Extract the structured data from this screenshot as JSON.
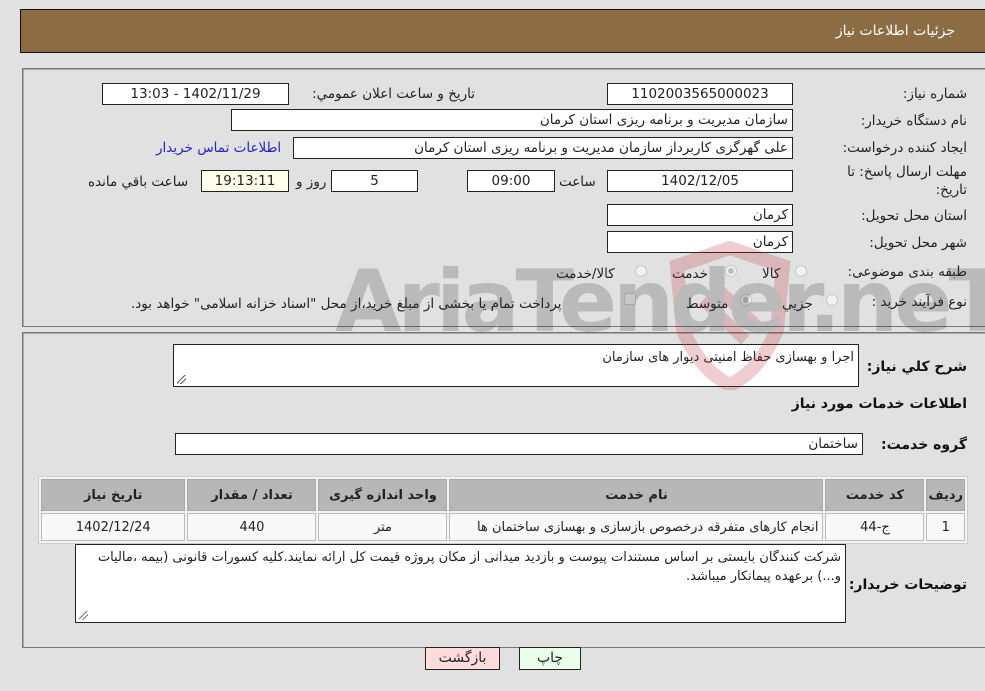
{
  "header": {
    "title": "جزئیات اطلاعات نیاز"
  },
  "fields": {
    "need_number": {
      "label": "شماره نیاز:",
      "value": "1102003565000023"
    },
    "announce_datetime": {
      "label": "تاريخ و ساعت اعلان عمومي:",
      "value": "1402/11/29 - 13:03"
    },
    "buyer_org": {
      "label": "نام دستگاه خريدار:",
      "value": "سازمان مدیریت و برنامه ریزی استان کرمان"
    },
    "requester": {
      "label": "ايجاد کننده درخواست:",
      "value": "علی گهرگزی کاربرداز سازمان مدیریت و برنامه ریزی استان کرمان"
    },
    "buyer_contact_link": "اطلاعات تماس خريدار",
    "deadline": {
      "label_line1": "مهلت ارسال پاسخ: تا",
      "label_line2": "تاريخ:",
      "date": "1402/12/05",
      "time_label": "ساعت",
      "time": "09:00",
      "days": "5",
      "days_label": "روز و",
      "remaining": "19:13:11",
      "remaining_label": "ساعت باقي مانده"
    },
    "delivery_province": {
      "label": "استان محل تحويل:",
      "value": "کرمان"
    },
    "delivery_city": {
      "label": "شهر محل تحويل:",
      "value": "کرمان"
    },
    "category": {
      "label": "طبقه بندی موضوعی:",
      "options": [
        "کالا",
        "خدمت",
        "کالا/خدمت"
      ],
      "selected": "خدمت"
    },
    "process_type": {
      "label": "نوع فرآيند خريد :",
      "options": [
        "جزيي",
        "متوسط"
      ],
      "selected": "متوسط",
      "treasury_note": "پرداخت تمام يا بخشی از مبلغ خريد،از محل \"اسناد خزانه اسلامی\" خواهد بود.",
      "treasury_checked": false
    }
  },
  "description": {
    "label": "شرح کلي نياز:",
    "value": "اجرا و بهسازی حفاظ امنیتی دیوار های سازمان"
  },
  "services_section_title": "اطلاعات خدمات مورد نياز",
  "service_group": {
    "label": "گروه خدمت:",
    "value": "ساختمان"
  },
  "table": {
    "headers": [
      "رديف",
      "کد خدمت",
      "نام خدمت",
      "واحد اندازه گيری",
      "تعداد / مقدار",
      "تاريخ نياز"
    ],
    "rows": [
      [
        "1",
        "ج-44",
        "انجام کارهای متفرقه درخصوص بازسازی و بهسازی ساختمان ها",
        "متر",
        "440",
        "1402/12/24"
      ]
    ]
  },
  "buyer_notes": {
    "label": "توضيحات خريدار:",
    "value": "شرکت کنندگان بایستی بر اساس مستندات پیوست و بازدید میدانی از مکان پروژه قیمت کل ارائه نمایند.کلیه کسورات قانونی (بیمه ،مالیات و...) برعهده پیمانکار میباشد."
  },
  "buttons": {
    "print": "چاپ",
    "back": "بازگشت"
  },
  "watermark": "AriaTender.neT",
  "colors": {
    "header_bg": "#8c6d43",
    "print_bg": "#eaffea",
    "back_bg": "#ffdcdc",
    "remaining_bg": "#ffffea",
    "link": "#2222cc"
  }
}
